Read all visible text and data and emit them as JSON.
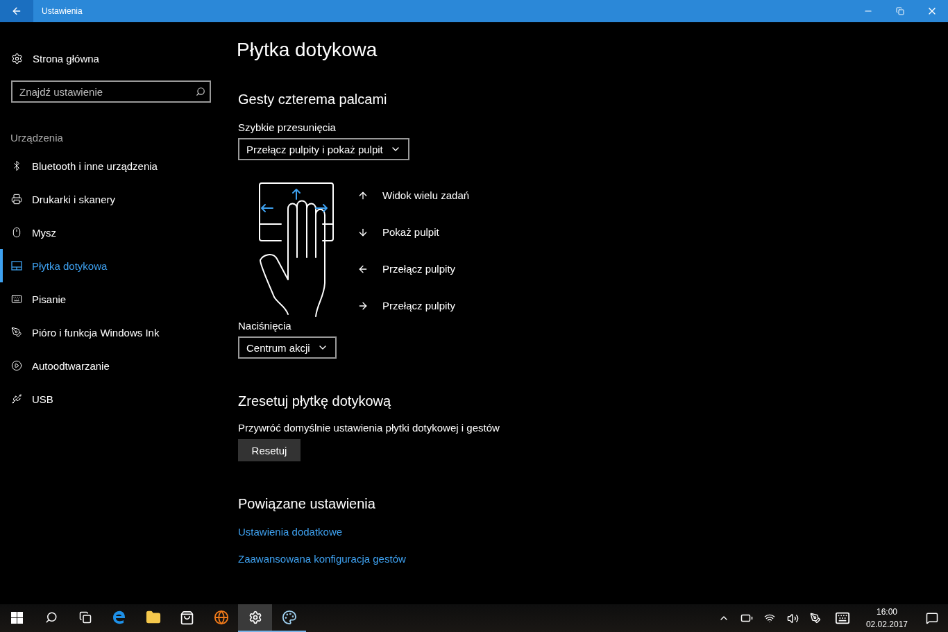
{
  "window": {
    "title": "Ustawienia"
  },
  "sidebar": {
    "home": "Strona główna",
    "search": {
      "placeholder": "Znajdź ustawienie"
    },
    "group": "Urządzenia",
    "items": [
      {
        "kind": "bluetooth",
        "label": "Bluetooth i inne urządzenia",
        "selected": false
      },
      {
        "kind": "printer",
        "label": "Drukarki i skanery",
        "selected": false
      },
      {
        "kind": "mouse",
        "label": "Mysz",
        "selected": false
      },
      {
        "kind": "touchpad",
        "label": "Płytka dotykowa",
        "selected": true
      },
      {
        "kind": "keyboard",
        "label": "Pisanie",
        "selected": false
      },
      {
        "kind": "pen",
        "label": "Pióro i funkcja Windows Ink",
        "selected": false
      },
      {
        "kind": "autoplay",
        "label": "Autoodtwarzanie",
        "selected": false
      },
      {
        "kind": "usb",
        "label": "USB",
        "selected": false
      }
    ]
  },
  "page": {
    "title": "Płytka dotykowa",
    "gestures": {
      "heading": "Gesty czterema palcami",
      "swipes_label": "Szybkie przesunięcia",
      "swipes_value": "Przełącz pulpity i pokaż pulpit",
      "items": [
        {
          "kind": "up",
          "label": "Widok wielu zadań"
        },
        {
          "kind": "down",
          "label": "Pokaż pulpit"
        },
        {
          "kind": "left",
          "label": "Przełącz pulpity"
        },
        {
          "kind": "right",
          "label": "Przełącz pulpity"
        }
      ],
      "taps_label": "Naciśnięcia",
      "taps_value": "Centrum akcji"
    },
    "reset": {
      "heading": "Zresetuj płytkę dotykową",
      "description": "Przywróć domyślnie ustawienia płytki dotykowej i gestów",
      "button": "Resetuj"
    },
    "related": {
      "heading": "Powiązane ustawienia",
      "links": [
        "Ustawienia dodatkowe",
        "Zaawansowana konfiguracja gestów"
      ]
    }
  },
  "taskbar": {
    "apps": [
      {
        "kind": "start",
        "selected": false,
        "running": false
      },
      {
        "kind": "search",
        "selected": false,
        "running": false
      },
      {
        "kind": "taskview",
        "selected": false,
        "running": false
      },
      {
        "kind": "edge",
        "selected": false,
        "running": false
      },
      {
        "kind": "explorer",
        "selected": false,
        "running": false
      },
      {
        "kind": "store",
        "selected": false,
        "running": false
      },
      {
        "kind": "firefox",
        "selected": false,
        "running": false
      },
      {
        "kind": "settings",
        "selected": true,
        "running": true
      },
      {
        "kind": "paint",
        "selected": false,
        "running": true
      }
    ],
    "time": "16:00",
    "date": "02.02.2017"
  }
}
